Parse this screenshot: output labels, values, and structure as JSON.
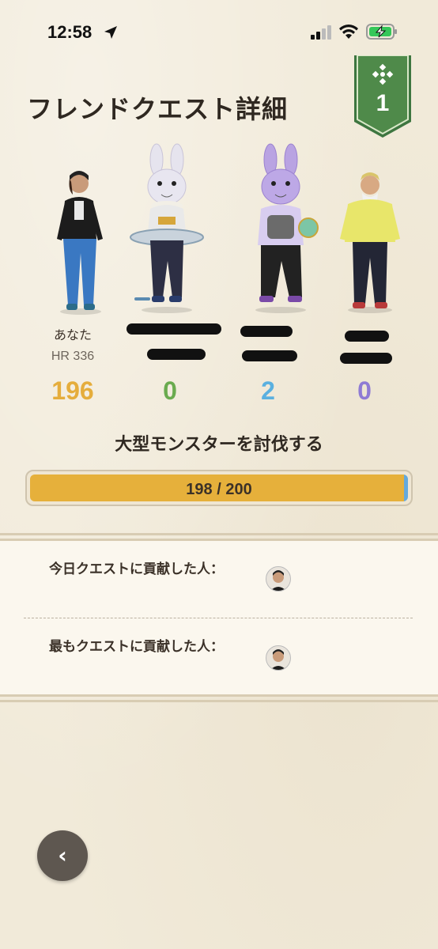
{
  "status_bar": {
    "time": "12:58"
  },
  "rank_badge": {
    "number": "1"
  },
  "page": {
    "title": "フレンドクエスト詳細"
  },
  "players": [
    {
      "name": "あなた",
      "hr": "HR 336",
      "score": "196",
      "score_color": "#e5ad3c"
    },
    {
      "name": "",
      "hr": "",
      "score": "0",
      "score_color": "#6aab4f"
    },
    {
      "name": "",
      "hr": "",
      "score": "2",
      "score_color": "#5ab0e0"
    },
    {
      "name": "",
      "hr": "",
      "score": "0",
      "score_color": "#8f7bd4"
    }
  ],
  "quest": {
    "objective": "大型モンスターを討伐する",
    "progress_text": "198 / 200",
    "progress_value": 198,
    "progress_max": 200
  },
  "contributions": {
    "today_label": "今日クエストに貢献した人：",
    "most_label": "最もクエストに貢献した人："
  },
  "colors": {
    "badge_green": "#4f8a4a",
    "progress_fill": "#e6b03b",
    "background": "#f1ead9"
  }
}
